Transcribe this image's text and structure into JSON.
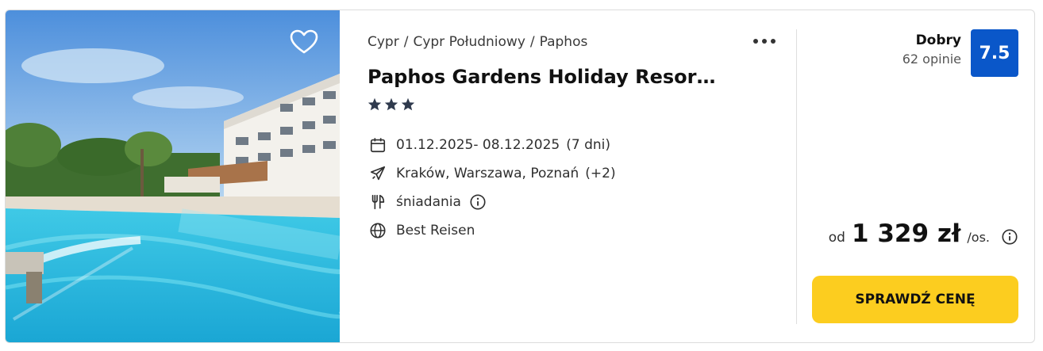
{
  "offer": {
    "breadcrumb": [
      "Cypr",
      "Cypr Południowy",
      "Paphos"
    ],
    "breadcrumb_separator": "/",
    "title": "Paphos Gardens Holiday Resor…",
    "stars": 3,
    "dates": "01.12.2025- 08.12.2025",
    "duration": "(7 dni)",
    "departure": "Kraków, Warszawa, Poznań",
    "departure_extra": "(+2)",
    "board": "śniadania",
    "operator": "Best Reisen"
  },
  "rating": {
    "label": "Dobry",
    "reviews": "62 opinie",
    "score": "7.5"
  },
  "price": {
    "from": "od",
    "amount": "1 329 zł",
    "per": "/os."
  },
  "cta": {
    "label": "SPRAWDŹ CENĘ"
  },
  "colors": {
    "accent": "#fccd1f",
    "score_bg": "#0a57c9",
    "stars": "#2f3a4d"
  },
  "icons": {
    "favorite": "heart-icon",
    "more": "more-dots-icon",
    "star": "star-icon",
    "dates": "calendar-icon",
    "departure": "plane-icon",
    "board": "cutlery-icon",
    "board_info": "info-icon",
    "operator": "globe-icon",
    "price_info": "info-icon"
  }
}
